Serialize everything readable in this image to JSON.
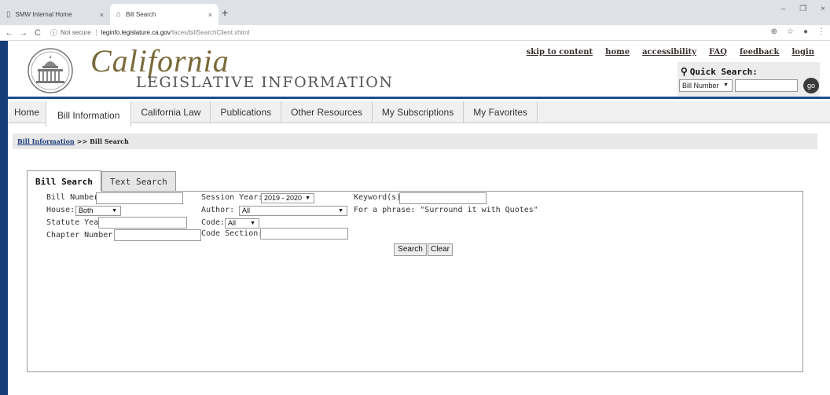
{
  "browser": {
    "tabs": [
      {
        "title": "SMW Internal Home",
        "close": "×"
      },
      {
        "title": "Bill Search",
        "close": "×"
      }
    ],
    "new_tab": "+",
    "url_security": "Not secure",
    "url_host": "leginfo.legislature.ca.gov",
    "url_path": "/faces/billSearchClient.xhtml",
    "window_controls": {
      "minimize": "–",
      "restore": "❐",
      "close": "×"
    },
    "nav": {
      "back": "←",
      "forward": "→",
      "reload": "C"
    },
    "addr_icons": {
      "zoom": "⊕",
      "star": "☆",
      "profile": "●",
      "menu": "⋮"
    }
  },
  "header": {
    "logo_script": "California",
    "logo_sub": "LEGISLATIVE INFORMATION",
    "links": [
      "skip to content",
      "home",
      "accessibility",
      "FAQ",
      "feedback",
      "login"
    ],
    "quick_search": {
      "title": "Quick Search:",
      "select_value": "Bill Number",
      "go_label": "go"
    }
  },
  "mainnav": [
    "Home",
    "Bill Information",
    "California Law",
    "Publications",
    "Other Resources",
    "My Subscriptions",
    "My Favorites"
  ],
  "breadcrumb": {
    "parent": "Bill Information",
    "separator": ">>",
    "current": "Bill Search"
  },
  "search_tabs": [
    "Bill Search",
    "Text Search"
  ],
  "form": {
    "bill_number_label": "Bill Number:",
    "house_label": "House:",
    "house_value": "Both",
    "statute_year_label": "Statute Year:",
    "chapter_number_label": "Chapter Number:",
    "session_year_label": "Session Year:",
    "session_year_value": "2019 - 2020",
    "author_label": "Author:",
    "author_value": "All",
    "code_label": "Code:",
    "code_value": "All",
    "code_section_label": "Code Section:",
    "keywords_label": "Keyword(s):",
    "phrase_hint": "For a phrase: \"Surround it with Quotes\"",
    "search_button": "Search",
    "clear_button": "Clear"
  }
}
